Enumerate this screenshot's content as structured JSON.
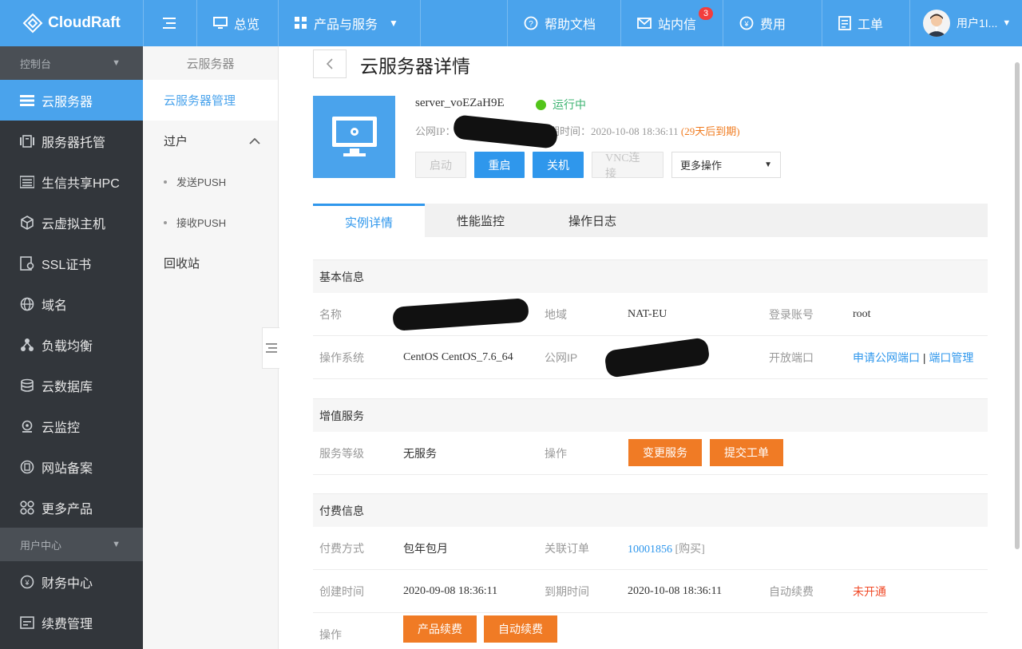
{
  "header": {
    "logo": "CloudRaft",
    "overview": "总览",
    "products": "产品与服务",
    "help": "帮助文档",
    "messages": "站内信",
    "message_count": "3",
    "billing": "费用",
    "tickets": "工单",
    "user": "用户1I..."
  },
  "sidebar": {
    "console_label": "控制台",
    "items": [
      {
        "label": "云服务器",
        "icon": "server-icon"
      },
      {
        "label": "服务器托管",
        "icon": "rack-icon"
      },
      {
        "label": "生信共享HPC",
        "icon": "list-icon"
      },
      {
        "label": "云虚拟主机",
        "icon": "cube-icon"
      },
      {
        "label": "SSL证书",
        "icon": "certificate-icon"
      },
      {
        "label": "域名",
        "icon": "globe-icon"
      },
      {
        "label": "负载均衡",
        "icon": "balance-icon"
      },
      {
        "label": "云数据库",
        "icon": "database-icon"
      },
      {
        "label": "云监控",
        "icon": "monitor-icon"
      },
      {
        "label": "网站备案",
        "icon": "record-icon"
      },
      {
        "label": "更多产品",
        "icon": "grid-icon"
      }
    ],
    "user_center_label": "用户中心",
    "user_items": [
      {
        "label": "财务中心",
        "icon": "finance-icon"
      },
      {
        "label": "续费管理",
        "icon": "renew-icon"
      }
    ]
  },
  "subnav": {
    "title": "云服务器",
    "manage": "云服务器管理",
    "transfer": "过户",
    "send_push": "发送PUSH",
    "receive_push": "接收PUSH",
    "recycle": "回收站"
  },
  "page": {
    "title": "云服务器详情",
    "server_name": "server_voEZaH9E",
    "status": "运行中",
    "ip_label": "公网IP：",
    "expire_label": "到期时间：",
    "expire_value": "2020-10-08 18:36:11",
    "expire_warn": "(29天后到期)",
    "actions": {
      "start": "启动",
      "restart": "重启",
      "shutdown": "关机",
      "vnc": "VNC连接",
      "more": "更多操作"
    }
  },
  "tabs": [
    "实例详情",
    "性能监控",
    "操作日志"
  ],
  "basic": {
    "title": "基本信息",
    "name_label": "名称",
    "region_label": "地域",
    "region_value": "NAT-EU",
    "login_label": "登录账号",
    "login_value": "root",
    "os_label": "操作系统",
    "os_value": "CentOS CentOS_7.6_64",
    "ip_label": "公网IP",
    "port_label": "开放端口",
    "port_apply": "申请公网端口",
    "port_sep": "|",
    "port_manage": "端口管理"
  },
  "value_added": {
    "title": "增值服务",
    "level_label": "服务等级",
    "level_value": "无服务",
    "op_label": "操作",
    "change_btn": "变更服务",
    "ticket_btn": "提交工单"
  },
  "payment": {
    "title": "付费信息",
    "method_label": "付费方式",
    "method_value": "包年包月",
    "order_label": "关联订单",
    "order_value": "10001856",
    "order_buy": "[购买]",
    "created_label": "创建时间",
    "created_value": "2020-09-08 18:36:11",
    "expire_label": "到期时间",
    "expire_value": "2020-10-08 18:36:11",
    "autorenew_label": "自动续费",
    "autorenew_value": "未开通",
    "op_label": "操作",
    "renew_btn": "产品续费",
    "autorenew_btn": "自动续费"
  },
  "colors": {
    "primary": "#4aa3ec",
    "sidebar": "#32363b",
    "orange": "#f07b25",
    "success": "#52c41a"
  }
}
